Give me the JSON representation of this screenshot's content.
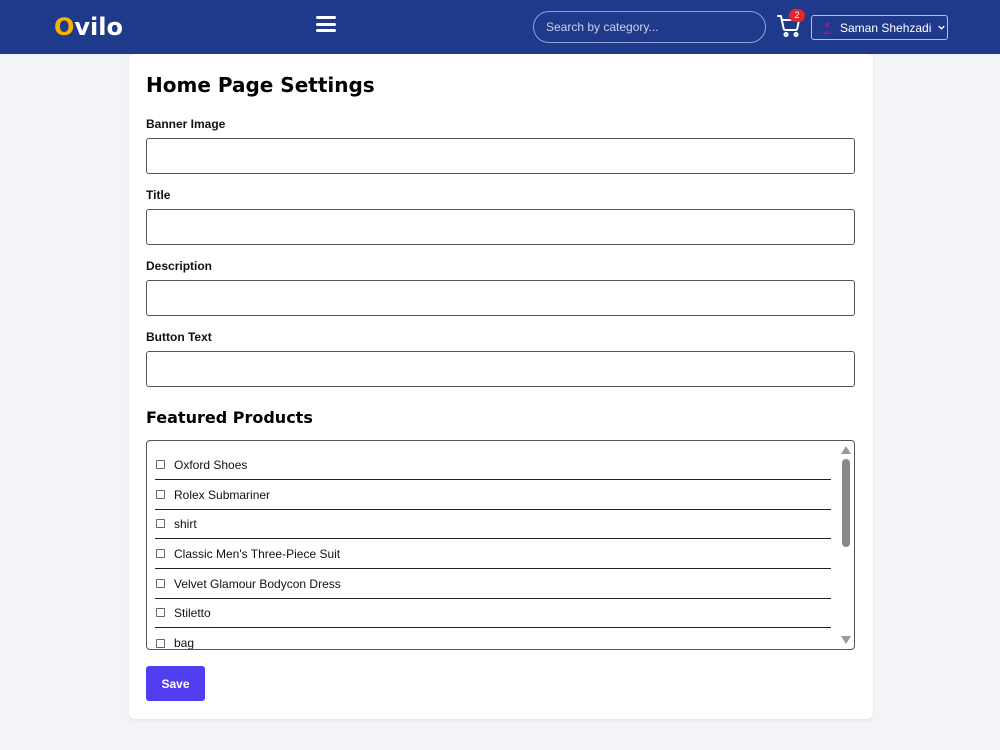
{
  "navbar": {
    "logo_initial": "O",
    "logo_rest": "vilo",
    "search_placeholder": "Search by category...",
    "cart_count": "2",
    "user_name": "Saman Shehzadi",
    "colors": {
      "bar": "#1f3a8a",
      "logo_accent": "#f5b400",
      "badge": "#e5262c"
    }
  },
  "page": {
    "title": "Home Page Settings",
    "fields": [
      {
        "label": "Banner Image",
        "value": ""
      },
      {
        "label": "Title",
        "value": ""
      },
      {
        "label": "Description",
        "value": ""
      },
      {
        "label": "Button Text",
        "value": ""
      }
    ],
    "featured": {
      "title": "Featured Products",
      "items": [
        "Oxford Shoes",
        "Rolex Submariner",
        "shirt",
        "Classic Men's Three-Piece Suit",
        "Velvet Glamour Bodycon Dress",
        "Stiletto",
        "bag"
      ]
    },
    "save_label": "Save",
    "colors": {
      "save_button": "#4f3ff0"
    }
  }
}
